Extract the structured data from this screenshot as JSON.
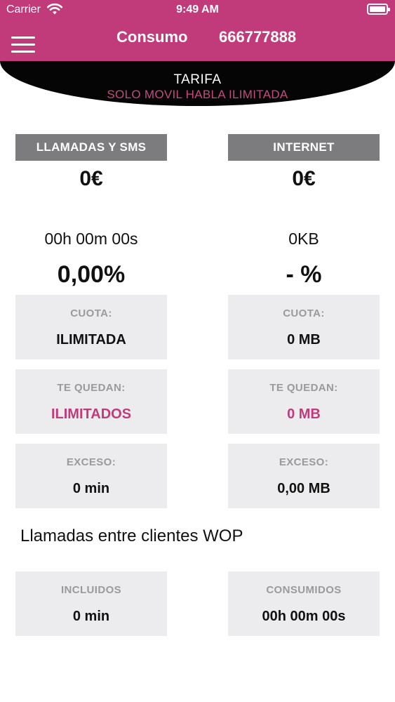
{
  "status_bar": {
    "carrier": "Carrier",
    "time": "9:49 AM"
  },
  "header": {
    "title": "Consumo",
    "phone": "666777888",
    "accent_color": "#c13a7a"
  },
  "tarifa": {
    "label": "TARIFA",
    "plan": "SOLO MOVIL HABLA ILIMITADA"
  },
  "calls": {
    "header": "LLAMADAS Y SMS",
    "amount": "0€",
    "used": "00h 00m 00s",
    "percent": "0,00%",
    "cuota_label": "CUOTA:",
    "cuota_value": "ILIMITADA",
    "quedan_label": "TE QUEDAN:",
    "quedan_value": "ILIMITADOS",
    "exceso_label": "EXCESO:",
    "exceso_value": "0 min"
  },
  "internet": {
    "header": "INTERNET",
    "amount": "0€",
    "used": "0KB",
    "percent": "- %",
    "cuota_label": "CUOTA:",
    "cuota_value": "0 MB",
    "quedan_label": "TE QUEDAN:",
    "quedan_value": "0 MB",
    "exceso_label": "EXCESO:",
    "exceso_value": "0,00 MB"
  },
  "wop": {
    "title": "Llamadas entre clientes WOP",
    "incluidos_label": "INCLUIDOS",
    "incluidos_value": "0 min",
    "consumidos_label": "CONSUMIDOS",
    "consumidos_value": "00h 00m 00s"
  }
}
